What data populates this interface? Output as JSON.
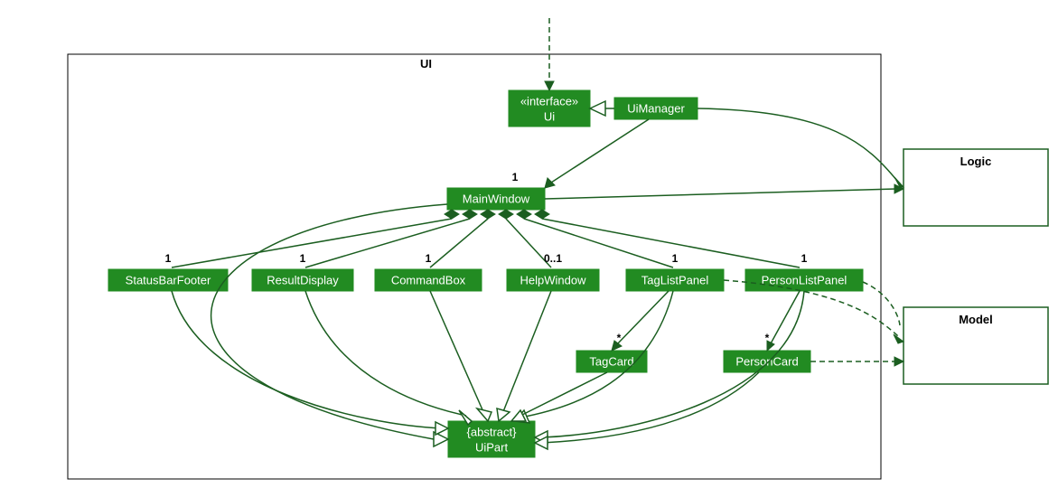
{
  "packages": {
    "ui": {
      "label": "UI"
    }
  },
  "external": {
    "logic": {
      "label": "Logic"
    },
    "model": {
      "label": "Model"
    }
  },
  "nodes": {
    "uiInterface": {
      "stereotype": "«interface»",
      "name": "Ui"
    },
    "uiManager": {
      "name": "UiManager"
    },
    "mainWindow": {
      "name": "MainWindow"
    },
    "statusBarFooter": {
      "name": "StatusBarFooter"
    },
    "resultDisplay": {
      "name": "ResultDisplay"
    },
    "commandBox": {
      "name": "CommandBox"
    },
    "helpWindow": {
      "name": "HelpWindow"
    },
    "tagListPanel": {
      "name": "TagListPanel"
    },
    "personListPanel": {
      "name": "PersonListPanel"
    },
    "tagCard": {
      "name": "TagCard"
    },
    "personCard": {
      "name": "PersonCard"
    },
    "uiPart": {
      "stereotype": "{abstract}",
      "name": "UiPart"
    }
  },
  "multiplicities": {
    "mainWindow": "1",
    "statusBarFooter": "1",
    "resultDisplay": "1",
    "commandBox": "1",
    "helpWindow": "0..1",
    "tagListPanel": "1",
    "personListPanel": "1",
    "tagCard": "*",
    "personCard": "*"
  }
}
